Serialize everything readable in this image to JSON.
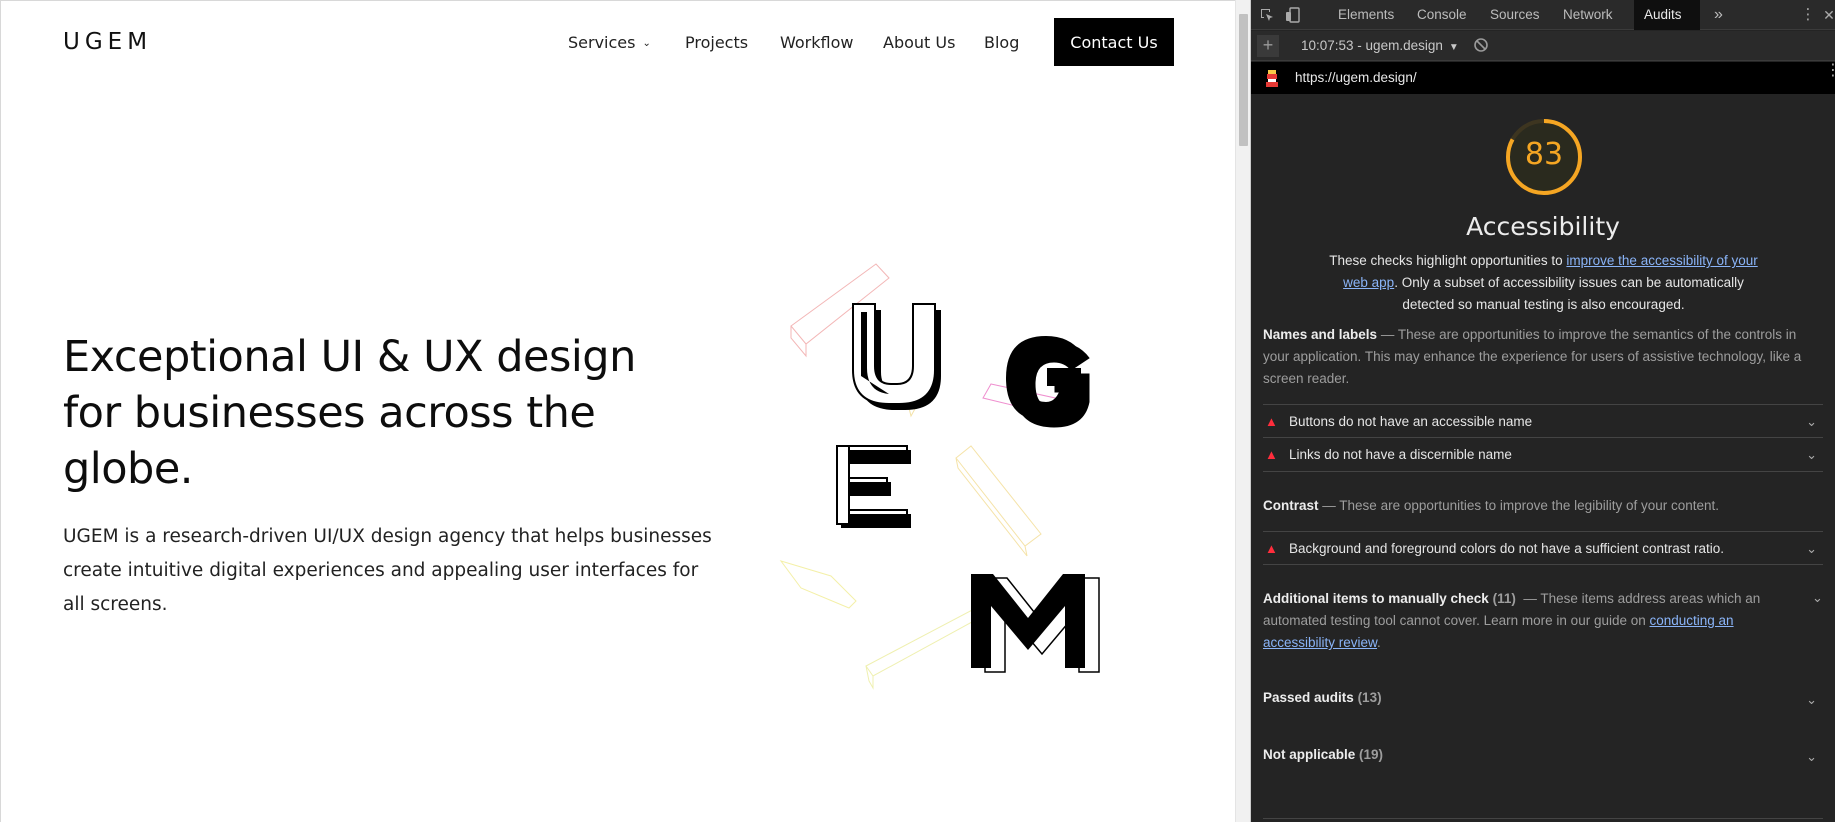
{
  "site": {
    "logo": "UGEM",
    "nav": [
      {
        "label": "Services",
        "dropdown": true
      },
      {
        "label": "Projects"
      },
      {
        "label": "Workflow"
      },
      {
        "label": "About Us"
      },
      {
        "label": "Blog"
      }
    ],
    "cta": "Contact Us",
    "hero_title": "Exceptional UI & UX design for businesses across the globe.",
    "hero_text": "UGEM is a research-driven UI/UX design agency that helps businesses create intuitive digital experiences and appealing user interfaces for all screens.",
    "art_letters": [
      "U",
      "G",
      "E",
      "M"
    ]
  },
  "devtools": {
    "tabs": [
      "Elements",
      "Console",
      "Sources",
      "Network",
      "Audits"
    ],
    "active_tab": "Audits",
    "more_tabs": "»",
    "new_audit": "+",
    "session": "10:07:53 - ugem.design",
    "url": "https://ugem.design/",
    "score": 83,
    "score_color": "#f5a623",
    "category_title": "Accessibility",
    "description_pre": "These checks highlight opportunities to ",
    "description_link": "improve the accessibility of your web app",
    "description_post": ". Only a subset of accessibility issues can be automatically detected so manual testing is also encouraged.",
    "names_labels": {
      "title": "Names and labels",
      "text": "These are opportunities to improve the semantics of the controls in your application. This may enhance the experience for users of assistive technology, like a screen reader."
    },
    "audits_names": [
      "Buttons do not have an accessible name",
      "Links do not have a discernible name"
    ],
    "contrast": {
      "title": "Contrast",
      "text": "These are opportunities to improve the legibility of your content."
    },
    "audits_contrast": [
      "Background and foreground colors do not have a sufficient contrast ratio."
    ],
    "manual": {
      "title": "Additional items to manually check",
      "count": "(11)",
      "text_pre": "These items address areas which an automated testing tool cannot cover. Learn more in our guide on ",
      "link": "conducting an accessibility review",
      "text_post": "."
    },
    "passed": {
      "title": "Passed audits",
      "count": "(13)"
    },
    "not_applicable": {
      "title": "Not applicable",
      "count": "(19)"
    },
    "dash": "—"
  }
}
